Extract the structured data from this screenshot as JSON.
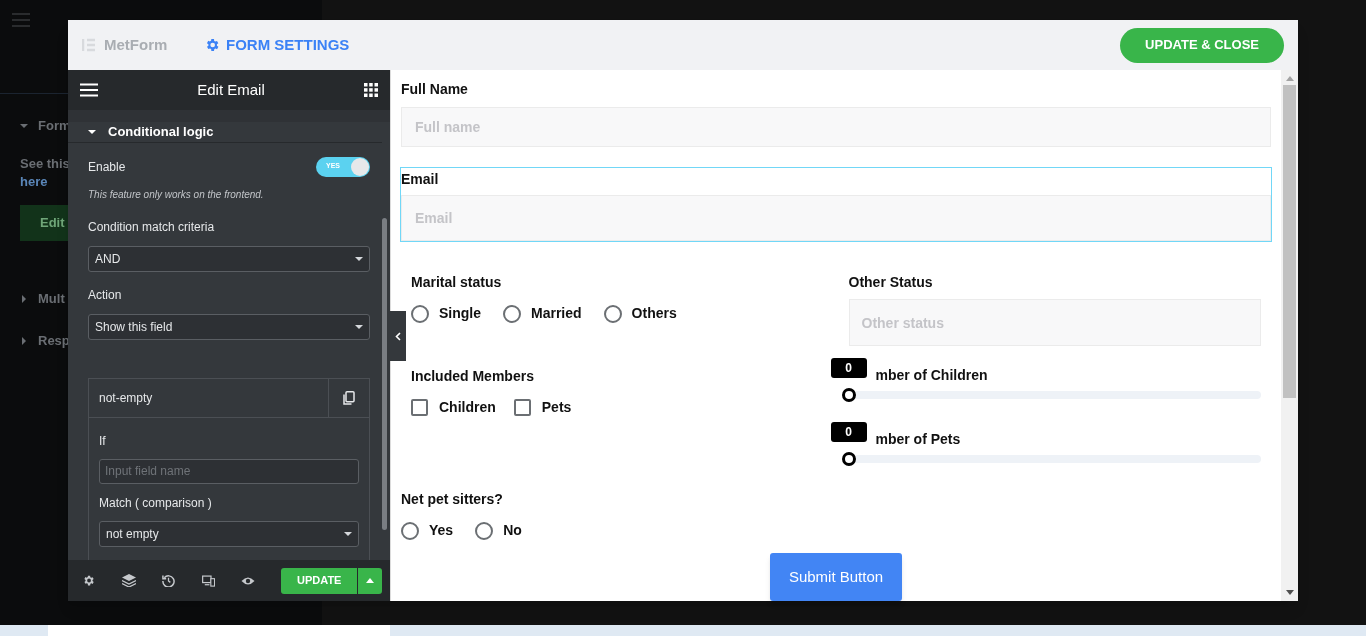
{
  "background_panel": {
    "items": [
      {
        "kind": "section",
        "text": "Form"
      },
      {
        "kind": "text",
        "text": "See this"
      },
      {
        "kind": "link",
        "text": "here"
      },
      {
        "kind": "button",
        "text": "Edit"
      },
      {
        "kind": "section",
        "text": "Mult"
      },
      {
        "kind": "section",
        "text": "Resp"
      }
    ]
  },
  "header": {
    "logo": "MetForm",
    "settings_tab": "FORM SETTINGS",
    "update_close": "UPDATE & CLOSE"
  },
  "panel": {
    "title": "Edit Email",
    "section": {
      "title": "Conditional logic",
      "expanded": true
    },
    "enable": {
      "label": "Enable",
      "on": true,
      "switch_text": "YES"
    },
    "note": "This feature only works on the frontend.",
    "criteria": {
      "label": "Condition match criteria",
      "value": "AND"
    },
    "action": {
      "label": "Action",
      "value": "Show this field"
    },
    "condition": {
      "title": "not-empty",
      "if_label": "If",
      "if_placeholder": "Input field name",
      "match_label": "Match ( comparison )",
      "match_value": "not empty"
    },
    "update": "UPDATE"
  },
  "form": {
    "full_name": {
      "label": "Full Name",
      "placeholder": "Full name"
    },
    "email": {
      "label": "Email",
      "placeholder": "Email",
      "selected": true
    },
    "marital": {
      "label": "Marital status",
      "options": [
        {
          "label": "Single",
          "selected": false
        },
        {
          "label": "Married",
          "selected": false
        },
        {
          "label": "Others",
          "selected": false
        }
      ]
    },
    "other_status": {
      "label": "Other Status",
      "placeholder": "Other status"
    },
    "members": {
      "label": "Included Members",
      "options": [
        {
          "label": "Children",
          "checked": false
        },
        {
          "label": "Pets",
          "checked": false
        }
      ]
    },
    "sliders": [
      {
        "label": "mber of Children",
        "value": "0",
        "level": 0
      },
      {
        "label": "mber of Pets",
        "value": "0",
        "level": 0
      }
    ],
    "sitters": {
      "label": "Net pet sitters?",
      "options": [
        {
          "label": "Yes",
          "selected": false
        },
        {
          "label": "No",
          "selected": false
        }
      ]
    },
    "submit": "Submit Button"
  }
}
